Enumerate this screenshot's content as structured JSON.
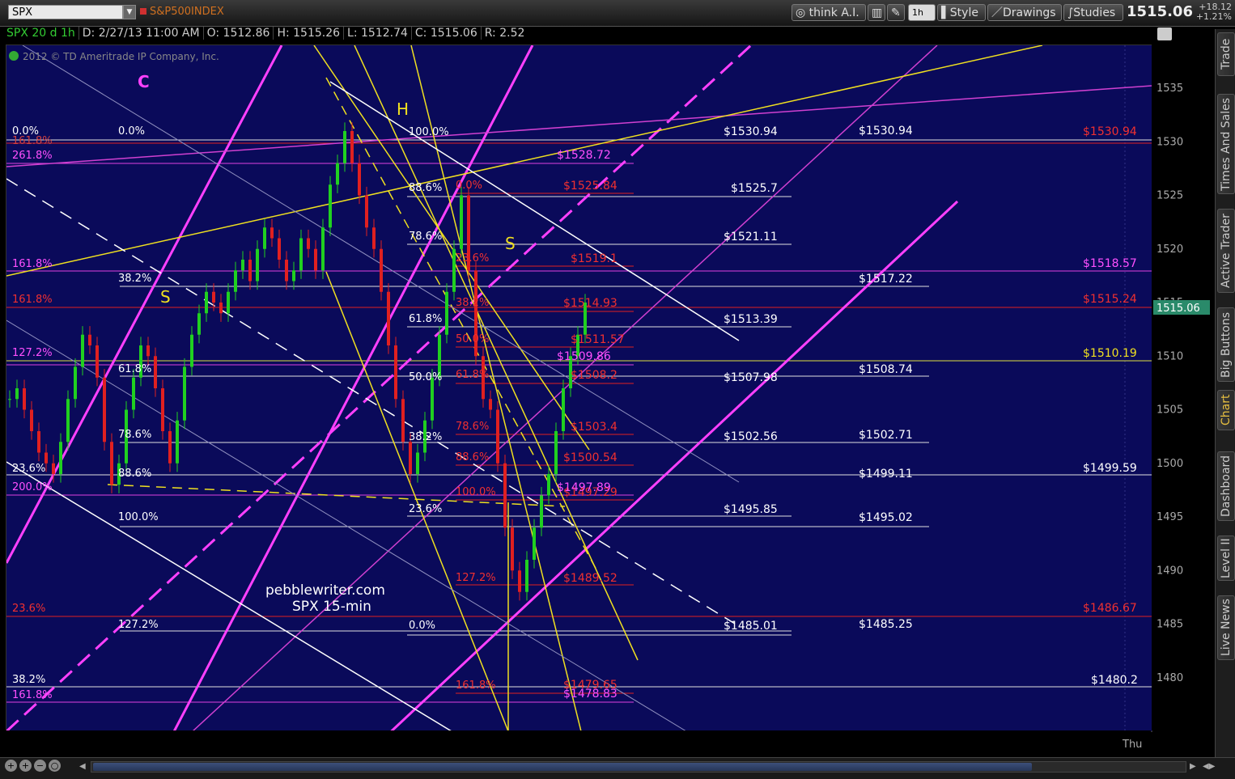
{
  "toolbar": {
    "symbol": "SPX",
    "description": "S&P500INDEX",
    "think_ai": "think A.I.",
    "period": "1h",
    "style": "Style",
    "drawings": "Drawings",
    "studies": "Studies",
    "last_price": "1515.06",
    "change_abs": "+18.12",
    "change_pct": "+1.21%"
  },
  "infobar": {
    "ticker": "SPX 20 d 1h",
    "date": "D: 2/27/13 11:00 AM",
    "open": "O: 1512.86",
    "high": "H: 1515.26",
    "low": "L: 1512.74",
    "close": "C: 1515.06",
    "range": "R: 2.52"
  },
  "copyright": "2012 © TD Ameritrade IP Company, Inc.",
  "watermark": {
    "line1": "pebblewriter.com",
    "line2": "SPX 15-min"
  },
  "yaxis": {
    "labels": [
      "1535",
      "1530",
      "1525",
      "1520",
      "1515",
      "1510",
      "1505",
      "1500",
      "1495",
      "1490",
      "1485",
      "1480"
    ],
    "current": "1515.06"
  },
  "xaxis": {
    "label": "Thu"
  },
  "sidebar": [
    "Trade",
    "Times And Sales",
    "Active Trader",
    "Big Buttons",
    "Chart",
    "Dashboard",
    "Level II",
    "Live News"
  ],
  "chart_data": {
    "type": "candlestick",
    "ylim": [
      1475,
      1539
    ],
    "pattern_labels": [
      "C",
      "H",
      "S",
      "S"
    ],
    "fib_labels_white": [
      "0.0%",
      "0.0%",
      "100.0%",
      "88.6%",
      "78.6%",
      "38.2%",
      "61.8%",
      "61.8%",
      "50.0%",
      "78.6%",
      "38.2%",
      "23.6%",
      "88.6%",
      "100.0%",
      "23.6%",
      "127.2%",
      "0.0%",
      "38.2%"
    ],
    "fib_labels_red": [
      "0.0%",
      "23.6%",
      "38.2%",
      "50.0%",
      "61.8%",
      "78.6%",
      "88.6%",
      "100.0%",
      "127.2%",
      "161.8%",
      "161.8%",
      "23.6%"
    ],
    "fib_labels_magenta": [
      "261.8%",
      "161.8%",
      "200.0%",
      "127.2%",
      "161.8%",
      "161.8%"
    ],
    "price_labels_white": [
      "$1530.94",
      "$1530.94",
      "$1525.7",
      "$1521.11",
      "$1517.22",
      "$1513.39",
      "$1507.98",
      "$1508.74",
      "$1502.56",
      "$1502.71",
      "$1499.11",
      "$1499.59",
      "$1495.85",
      "$1495.02",
      "$1485.01",
      "$1485.25",
      "$1480.2"
    ],
    "price_labels_red": [
      "$1530.94",
      "$1525.84",
      "$1519.1",
      "$1514.93",
      "$1511.57",
      "$1508.2",
      "$1503.4",
      "$1500.54",
      "$1497.29",
      "$1489.52",
      "$1479.65",
      "$1515.24",
      "$1486.67"
    ],
    "price_labels_magenta": [
      "$1528.72",
      "$1509.86",
      "$1497.89",
      "$1478.83",
      "$1518.57"
    ],
    "price_labels_yellow": [
      "$1510.19"
    ]
  }
}
